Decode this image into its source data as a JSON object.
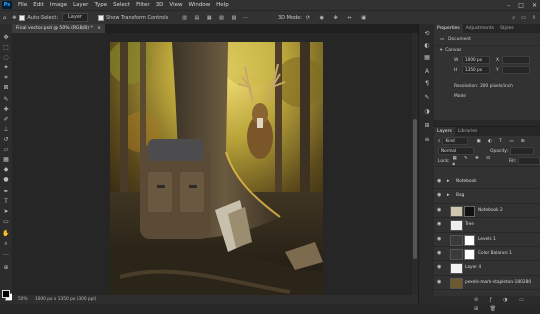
{
  "menubar": {
    "app_badge": "Ps",
    "items": [
      "File",
      "Edit",
      "Image",
      "Layer",
      "Type",
      "Select",
      "Filter",
      "3D",
      "View",
      "Window",
      "Help"
    ],
    "window_controls": [
      "–",
      "□",
      "✕"
    ]
  },
  "options_bar": {
    "auto_select_label": "Auto-Select:",
    "auto_select_value": "Layer",
    "transform_label": "Show Transform Controls",
    "mode_label": "3D Mode:"
  },
  "document": {
    "tab_title": "Final vector.psd @ 50% (RGB/8) *",
    "close": "×"
  },
  "status_bar": {
    "zoom": "50%",
    "dimensions": "1000 px x 1350 px (300 ppi)"
  },
  "properties_panel": {
    "tabs": [
      "Properties",
      "Adjustments",
      "Styles"
    ],
    "active_tab": "Properties",
    "section": "Document",
    "canvas_heading": "Canvas",
    "width_label": "W",
    "width_value": "1000 px",
    "height_label": "H",
    "height_value": "1350 px",
    "x_label": "X",
    "y_label": "Y",
    "resolution": "Resolution: 300 pixels/inch",
    "mode": "Mode"
  },
  "layers_panel": {
    "tabs": [
      "Layers",
      "Libraries"
    ],
    "active_tab": "Layers",
    "filter": "Kind",
    "blend": "Normal",
    "opacity_label": "Opacity:",
    "fill_label": "Fill:",
    "lock_label": "Lock:",
    "layers": [
      {
        "name": "Notebook",
        "type": "folder"
      },
      {
        "name": "Bag",
        "type": "folder"
      },
      {
        "name": "Notebook 2",
        "type": "layer"
      },
      {
        "name": "Tree",
        "type": "layer"
      },
      {
        "name": "Levels 1",
        "type": "adjustment"
      },
      {
        "name": "Color Balance 1",
        "type": "adjustment"
      },
      {
        "name": "Layer 4",
        "type": "layer"
      },
      {
        "name": "pexels-mark-stapleton-180280",
        "type": "layer"
      }
    ]
  },
  "colors": {
    "accent": "#31a8ff",
    "ui_dark": "#282828",
    "panel": "#323232"
  }
}
